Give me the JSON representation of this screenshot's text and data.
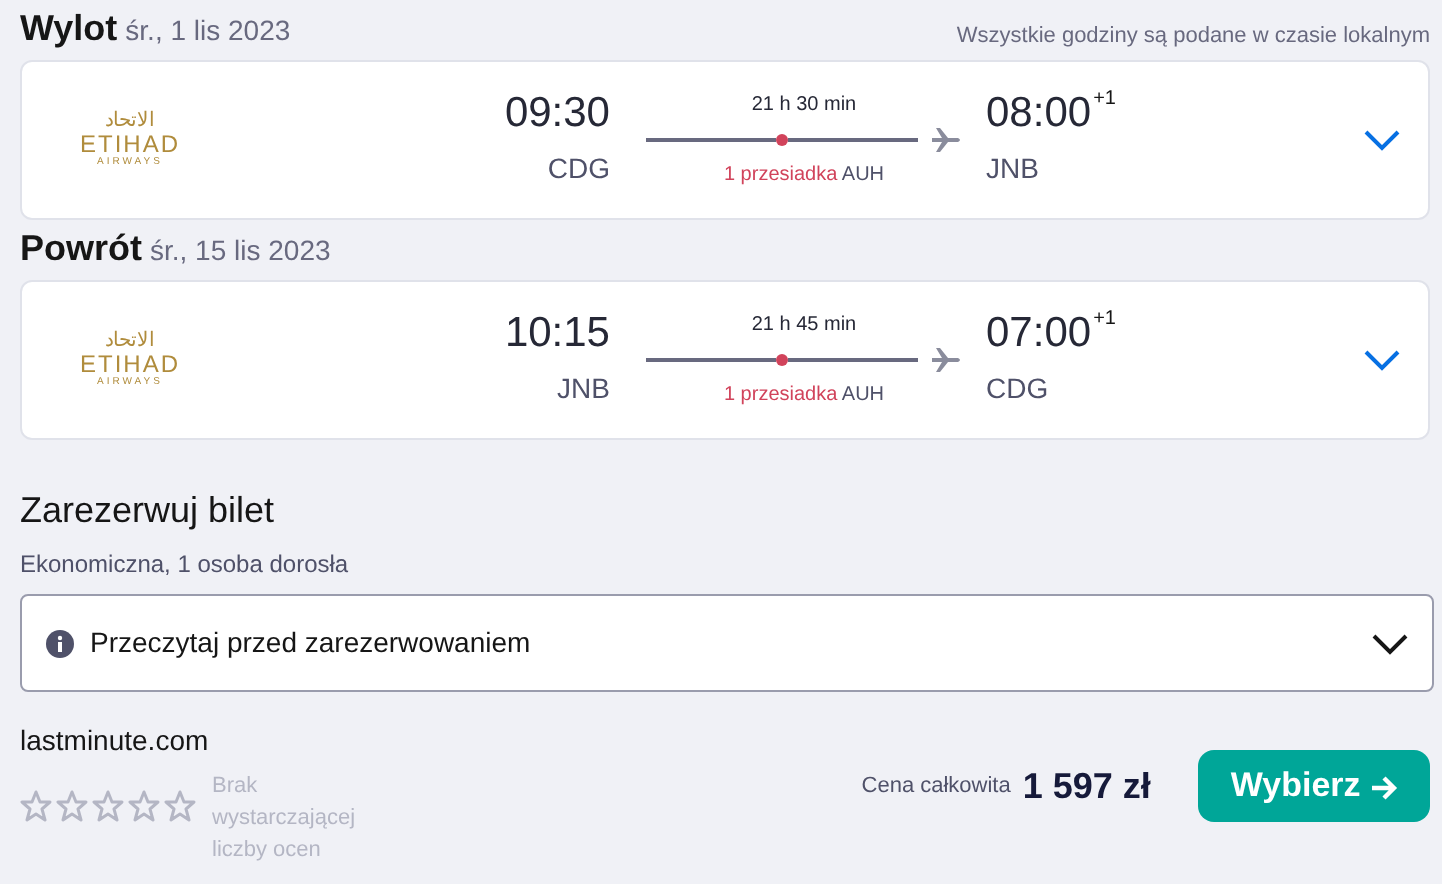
{
  "note": "Wszystkie godziny są podane w czasie lokalnym",
  "legs": [
    {
      "title": "Wylot",
      "date": "śr., 1 lis 2023",
      "airline": {
        "arabic": "الاتحاد",
        "name": "ETIHAD",
        "sub": "AIRWAYS"
      },
      "dep_time": "09:30",
      "dep_airport": "CDG",
      "duration": "21 h 30 min",
      "stops": "1 przesiadka",
      "stop_airport": "AUH",
      "arr_time": "08:00",
      "day_offset": "+1",
      "arr_airport": "JNB",
      "expanded": false
    },
    {
      "title": "Powrót",
      "date": "śr., 15 lis 2023",
      "airline": {
        "arabic": "الاتحاد",
        "name": "ETIHAD",
        "sub": "AIRWAYS"
      },
      "dep_time": "10:15",
      "dep_airport": "JNB",
      "duration": "21 h 45 min",
      "stops": "1 przesiadka",
      "stop_airport": "AUH",
      "arr_time": "07:00",
      "day_offset": "+1",
      "arr_airport": "CDG",
      "expanded": false
    }
  ],
  "booking": {
    "title": "Zarezerwuj bilet",
    "subtitle": "Ekonomiczna, 1 osoba dorosła",
    "info": {
      "label": "Przeczytaj przed zarezerwowaniem",
      "expanded": false
    },
    "provider": "lastminute.com",
    "stars": 0,
    "rating_text": "Brak wystarczającej liczby ocen",
    "price_label": "Cena całkowita",
    "price": "1 597 zł",
    "button": "Wybierz"
  }
}
